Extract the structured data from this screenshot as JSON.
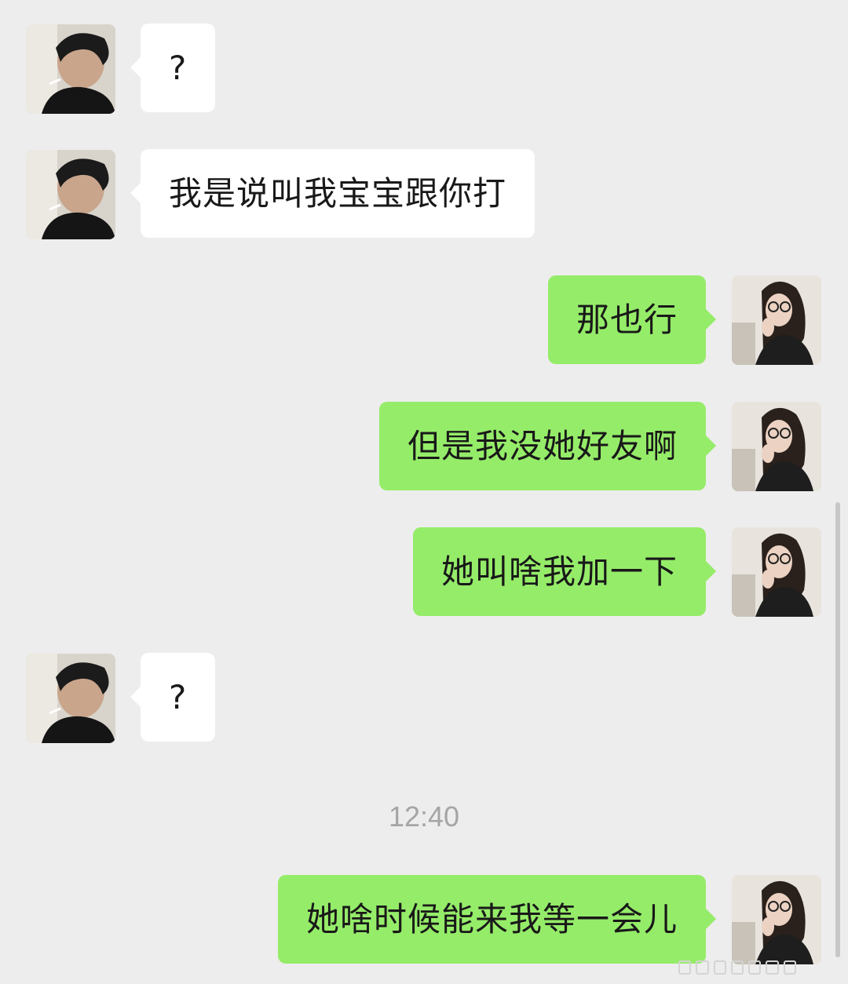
{
  "chat": {
    "messages": [
      {
        "sender": "left",
        "text": "?"
      },
      {
        "sender": "left",
        "text": "我是说叫我宝宝跟你打"
      },
      {
        "sender": "right",
        "text": "那也行"
      },
      {
        "sender": "right",
        "text": "但是我没她好友啊"
      },
      {
        "sender": "right",
        "text": "她叫啥我加一下"
      },
      {
        "sender": "left",
        "text": "?"
      },
      {
        "sender": "right",
        "text": "她啥时候能来我等一会儿"
      }
    ],
    "timestamp": "12:40"
  },
  "colors": {
    "background": "#ededed",
    "left_bubble": "#ffffff",
    "right_bubble": "#95ec69",
    "timestamp_text": "#a5a5a5"
  },
  "icons": {
    "left_avatar": "avatar-man-icon",
    "right_avatar": "avatar-woman-icon"
  }
}
